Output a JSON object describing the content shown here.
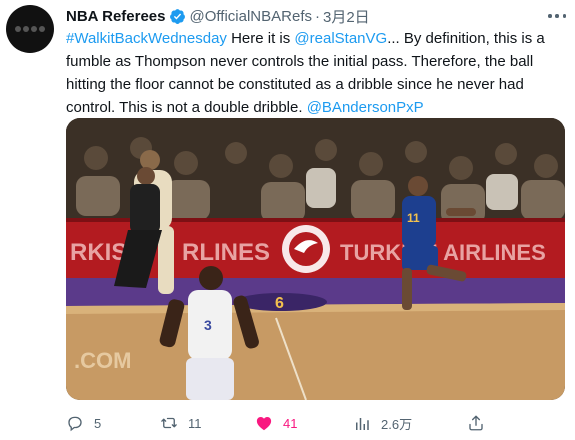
{
  "tweet": {
    "display_name": "NBA Referees",
    "handle": "@OfficialNBARefs",
    "separator": "·",
    "date": "3月2日",
    "text": {
      "hashtag": "#WalkitBackWednesday",
      "part1": " Here it is ",
      "mention1": "@realStanVG",
      "part2": "... By definition, this is a fumble as Thompson never controls the initial pass. Therefore, the ball hitting the floor cannot be constituted as a dribble since he never had control. This is not a double dribble. ",
      "mention2": "@BAndersonPxP"
    }
  },
  "media": {
    "banner_left": "RKISH",
    "banner_mid": "RLINES",
    "banner_right": "TURKISH AIRLINES",
    "court_number": "6",
    "court_text": ".COM",
    "jersey_blue": "11",
    "jersey_white": "3"
  },
  "actions": {
    "replies": "5",
    "retweets": "11",
    "likes": "41",
    "views": "2.6万"
  },
  "colors": {
    "link": "#1d9bf0",
    "like": "#f91880",
    "muted": "#536471",
    "verified": "#1d9bf0"
  }
}
